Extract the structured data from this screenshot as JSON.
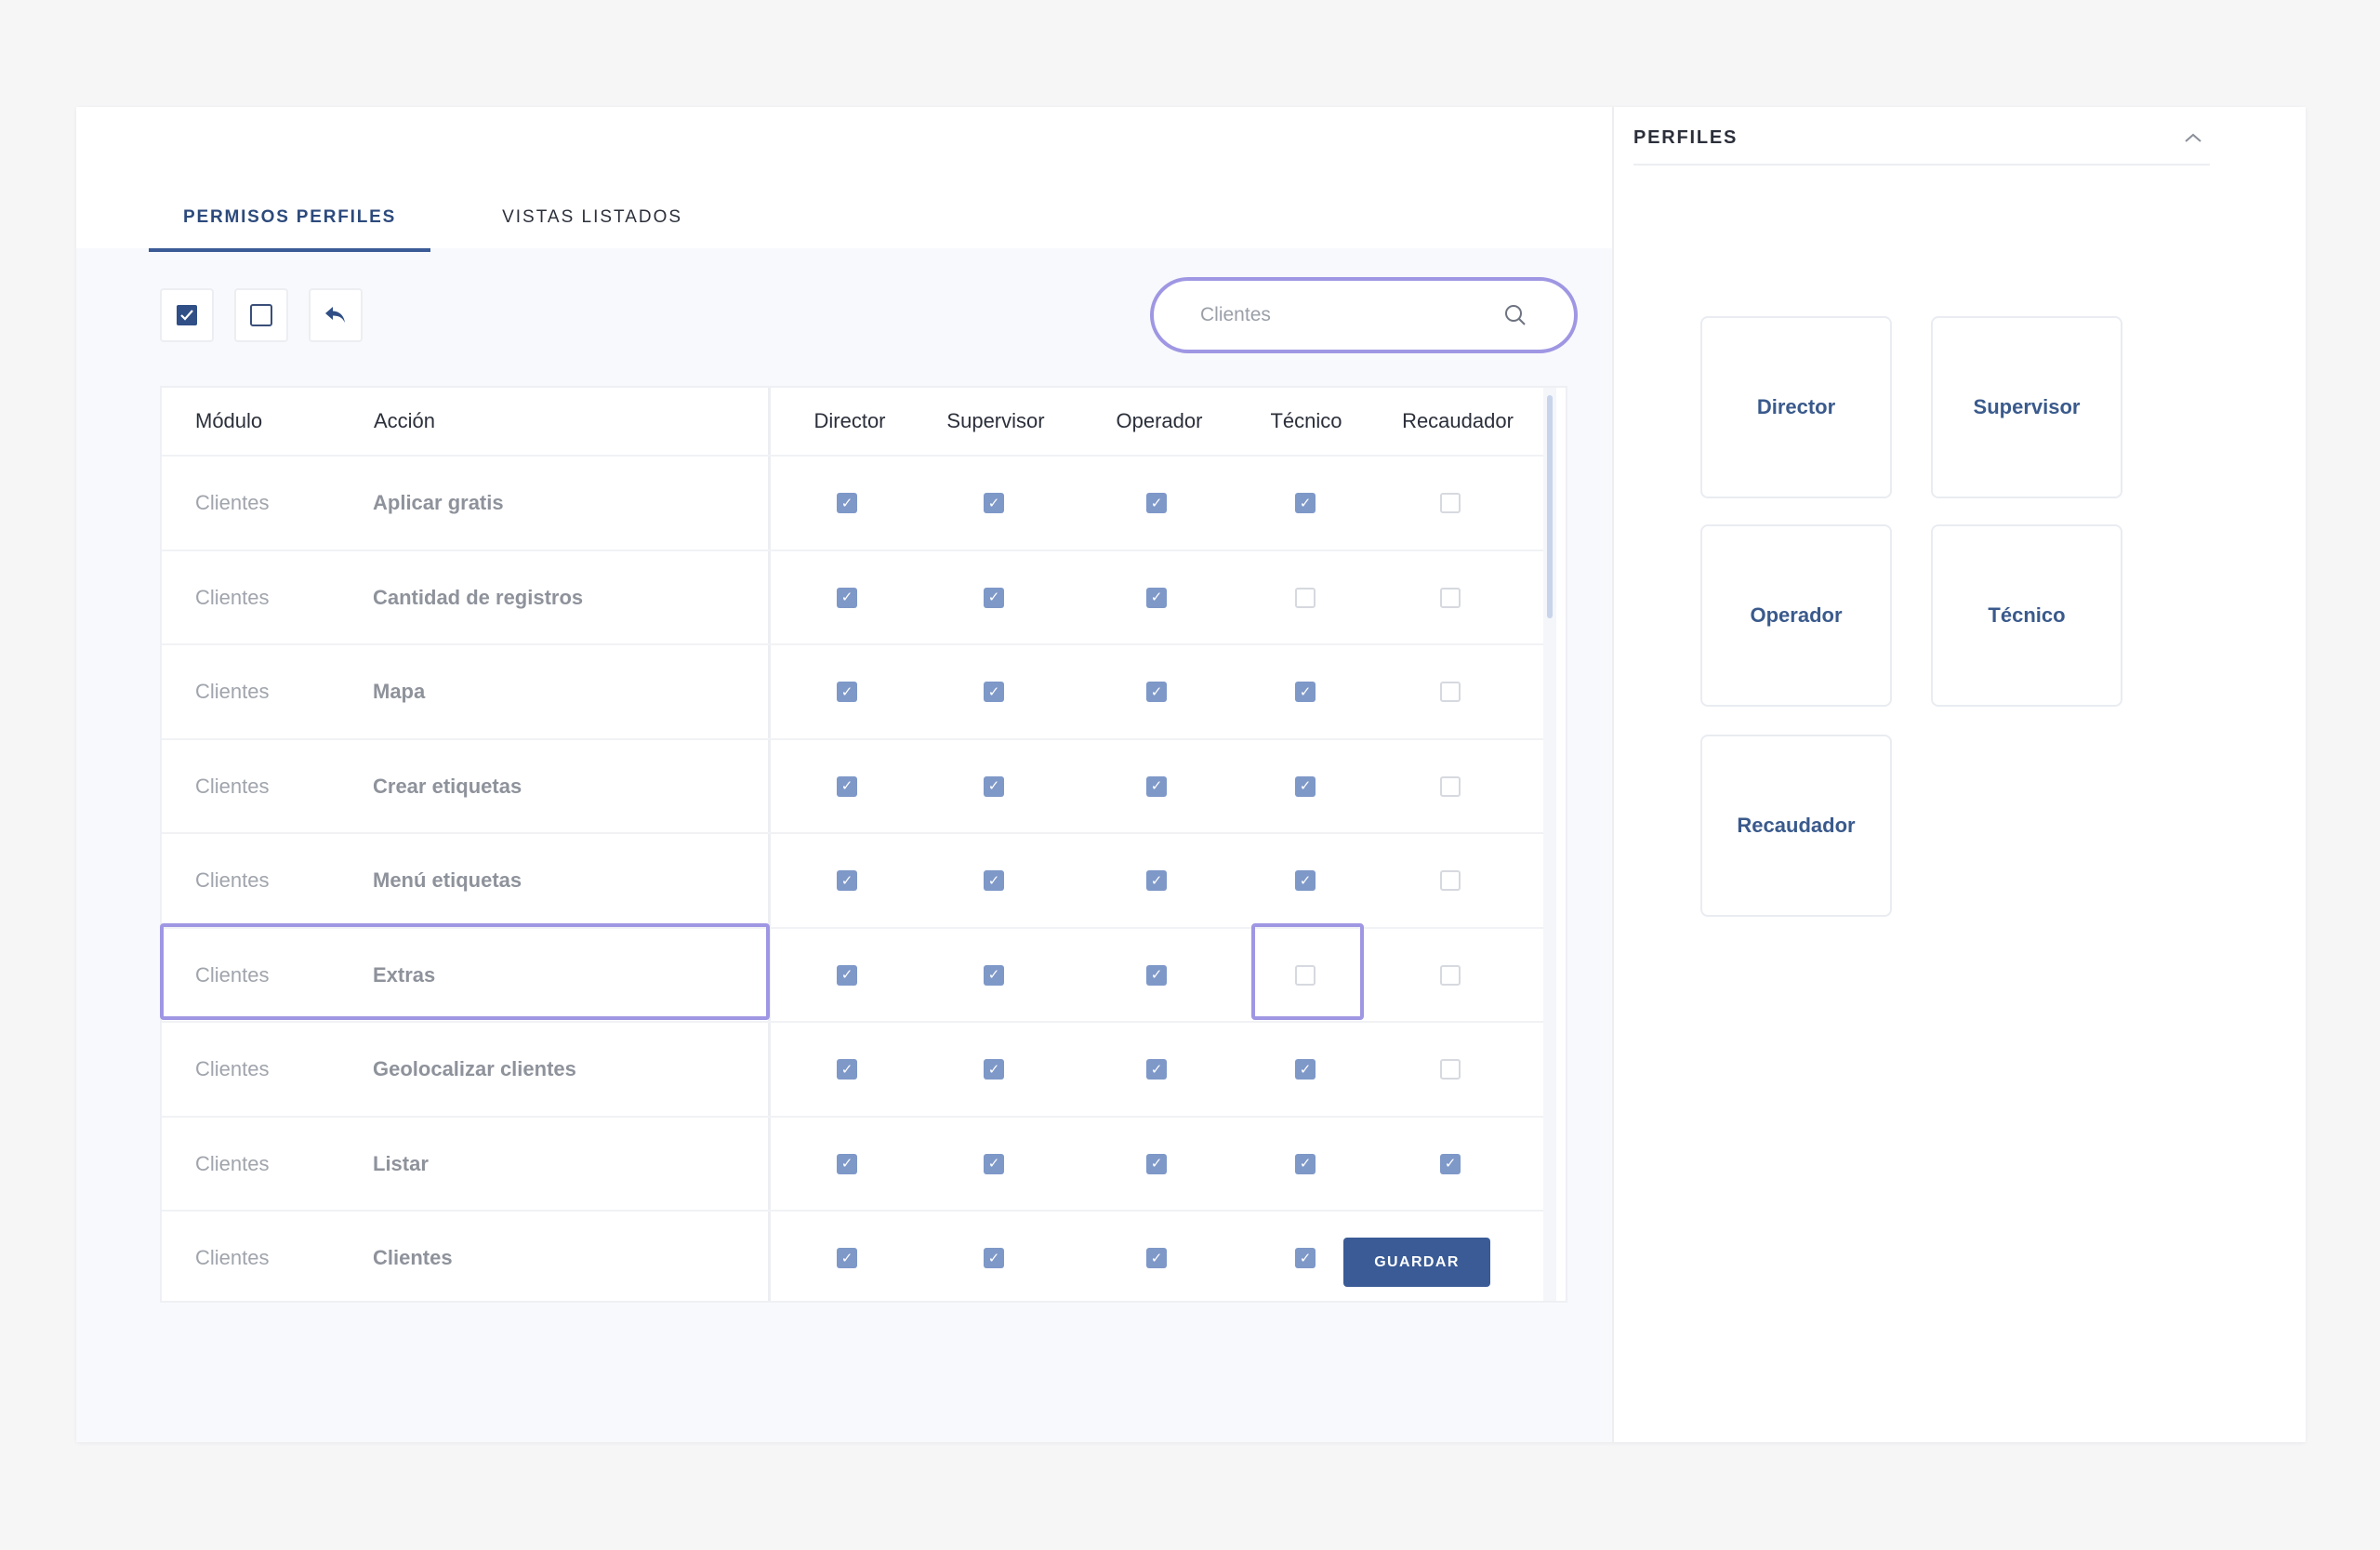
{
  "tabs": [
    {
      "label": "PERMISOS PERFILES",
      "active": true
    },
    {
      "label": "VISTAS LISTADOS",
      "active": false
    }
  ],
  "toolbar": {
    "check_all_icon": "checkbox-checked-icon",
    "uncheck_all_icon": "checkbox-empty-icon",
    "undo_icon": "reply-arrow-icon"
  },
  "search": {
    "placeholder": "Clientes",
    "icon": "search-icon"
  },
  "table": {
    "headers": {
      "modulo": "Módulo",
      "accion": "Acción",
      "profiles": [
        "Director",
        "Supervisor",
        "Operador",
        "Técnico",
        "Recaudador"
      ]
    },
    "rows": [
      {
        "modulo": "Clientes",
        "accion": "Aplicar gratis",
        "perms": [
          true,
          true,
          true,
          true,
          false
        ]
      },
      {
        "modulo": "Clientes",
        "accion": "Cantidad de registros",
        "perms": [
          true,
          true,
          true,
          false,
          false
        ]
      },
      {
        "modulo": "Clientes",
        "accion": "Mapa",
        "perms": [
          true,
          true,
          true,
          true,
          false
        ]
      },
      {
        "modulo": "Clientes",
        "accion": "Crear etiquetas",
        "perms": [
          true,
          true,
          true,
          true,
          false
        ]
      },
      {
        "modulo": "Clientes",
        "accion": "Menú etiquetas",
        "perms": [
          true,
          true,
          true,
          true,
          false
        ]
      },
      {
        "modulo": "Clientes",
        "accion": "Extras",
        "perms": [
          true,
          true,
          true,
          false,
          false
        ]
      },
      {
        "modulo": "Clientes",
        "accion": "Geolocalizar clientes",
        "perms": [
          true,
          true,
          true,
          true,
          false
        ]
      },
      {
        "modulo": "Clientes",
        "accion": "Listar",
        "perms": [
          true,
          true,
          true,
          true,
          true
        ]
      },
      {
        "modulo": "Clientes",
        "accion": "Clientes",
        "perms": [
          true,
          true,
          true,
          true,
          false
        ]
      }
    ]
  },
  "save_label": "GUARDAR",
  "profiles_panel": {
    "title": "PERFILES",
    "collapse_icon": "chevron-up-icon",
    "cards": [
      "Director",
      "Supervisor",
      "Operador",
      "Técnico",
      "Recaudador"
    ]
  },
  "colors": {
    "accent": "#3a5b96",
    "checkbox_on": "#7e98c8",
    "highlight": "#9f97e3"
  }
}
